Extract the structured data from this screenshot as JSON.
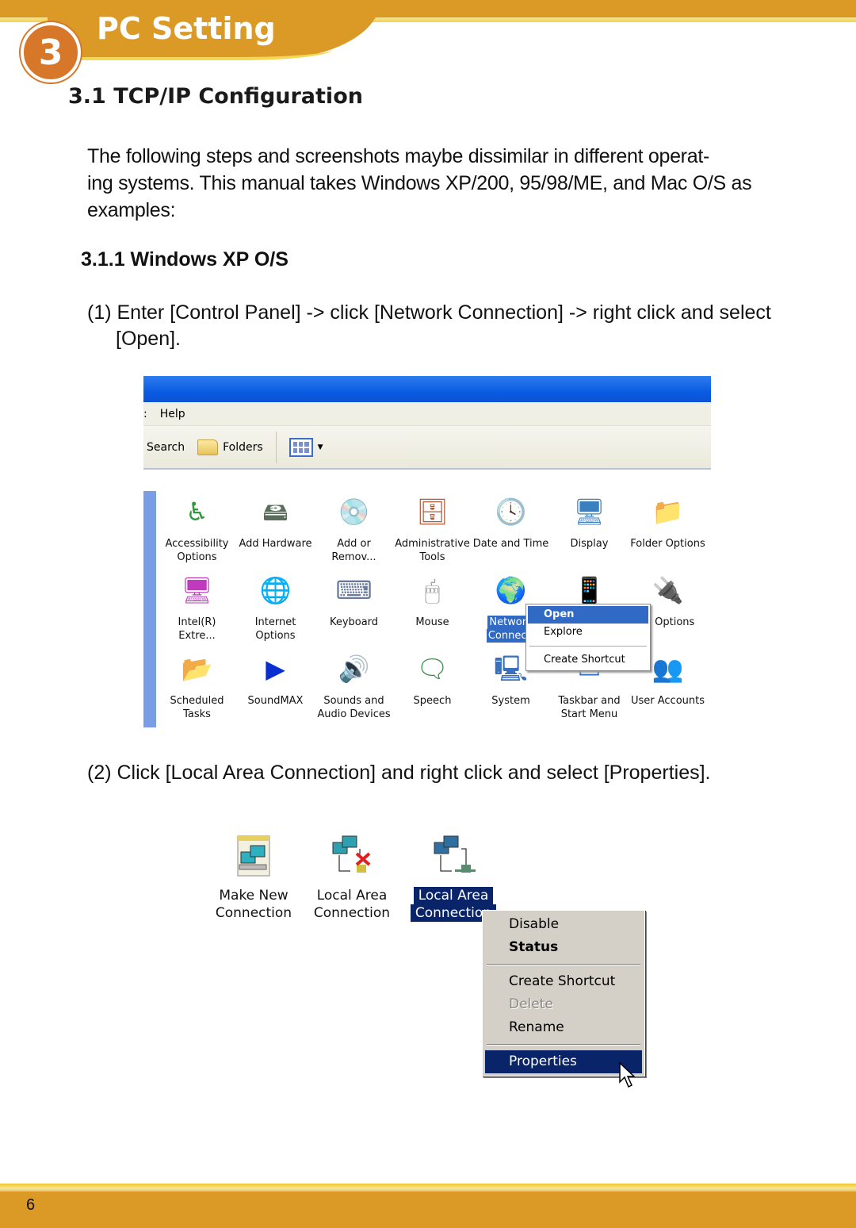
{
  "header": {
    "chapter_number": "3",
    "chapter_title": "PC Setting"
  },
  "section": {
    "title": "3.1 TCP/IP Configuration",
    "intro_line1": "The following steps and screenshots maybe dissimilar in  different operat-",
    "intro_line2": "ing systems. This manual takes Windows XP/200, 95/98/ME, and Mac O/S as",
    "intro_line3": "examples:",
    "subsection_title": "3.1.1 Windows XP O/S"
  },
  "steps": [
    {
      "line1": "(1) Enter [Control Panel] -> click [Network Connection] -> right click and select",
      "line2": "[Open]."
    },
    {
      "line1": "(2) Click [Local Area Connection] and right click and select [Properties]."
    }
  ],
  "screenshot1": {
    "menu": {
      "partial": ":",
      "help": "Help"
    },
    "toolbar": {
      "search": "Search",
      "folders": "Folders"
    },
    "items": [
      {
        "l1": "Accessibility",
        "l2": "Options",
        "icon": "accessibility-icon",
        "glyph": "♿",
        "color": "#2e9a3a"
      },
      {
        "l1": "Add Hardware",
        "l2": "",
        "icon": "add-hardware-icon",
        "glyph": "🖴",
        "color": "#5a6d5a"
      },
      {
        "l1": "Add or",
        "l2": "Remov...",
        "icon": "add-remove-programs-icon",
        "glyph": "💿",
        "color": "#4a7fc0"
      },
      {
        "l1": "Administrative",
        "l2": "Tools",
        "icon": "administrative-tools-icon",
        "glyph": "🗄",
        "color": "#b05a3a"
      },
      {
        "l1": "Date and Time",
        "l2": "",
        "icon": "date-time-icon",
        "glyph": "🕓",
        "color": "#5a7fb0"
      },
      {
        "l1": "Display",
        "l2": "",
        "icon": "display-icon",
        "glyph": "🖥",
        "color": "#3a7fc0"
      },
      {
        "l1": "Folder Options",
        "l2": "",
        "icon": "folder-options-icon",
        "glyph": "📁",
        "color": "#e0b040"
      },
      {
        "l1": "Intel(R)",
        "l2": "Extre...",
        "icon": "intel-graphics-icon",
        "glyph": "🖥",
        "color": "#c03ac0"
      },
      {
        "l1": "Internet",
        "l2": "Options",
        "icon": "internet-options-icon",
        "glyph": "🌐",
        "color": "#2f7fcf"
      },
      {
        "l1": "Keyboard",
        "l2": "",
        "icon": "keyboard-icon",
        "glyph": "⌨",
        "color": "#6a7a9a"
      },
      {
        "l1": "Mouse",
        "l2": "",
        "icon": "mouse-icon",
        "glyph": "🖱",
        "color": "#888888"
      },
      {
        "l1": "Network",
        "l2": "Connecti",
        "icon": "network-connections-icon",
        "glyph": "🌍",
        "color": "#2a6fb0",
        "selected": true
      },
      {
        "l1": "",
        "l2": "",
        "icon": "phone-modem-icon",
        "glyph": "📱",
        "color": "#5a8a5a"
      },
      {
        "l1": "er Options",
        "l2": "",
        "icon": "power-options-icon",
        "glyph": "🔌",
        "color": "#c0a040"
      },
      {
        "l1": "Scheduled",
        "l2": "Tasks",
        "icon": "scheduled-tasks-icon",
        "glyph": "📂",
        "color": "#e0b040"
      },
      {
        "l1": "SoundMAX",
        "l2": "",
        "icon": "soundmax-icon",
        "glyph": "▶",
        "color": "#0a2fd0"
      },
      {
        "l1": "Sounds and",
        "l2": "Audio Devices",
        "icon": "sounds-audio-icon",
        "glyph": "🔊",
        "color": "#707070"
      },
      {
        "l1": "Speech",
        "l2": "",
        "icon": "speech-icon",
        "glyph": "🗨",
        "color": "#3a8a4a"
      },
      {
        "l1": "System",
        "l2": "",
        "icon": "system-icon",
        "glyph": "🖳",
        "color": "#3a6fc0"
      },
      {
        "l1": "Taskbar and",
        "l2": "Start Menu",
        "icon": "taskbar-start-menu-icon",
        "glyph": "▭",
        "color": "#2a70c0"
      },
      {
        "l1": "User Accounts",
        "l2": "",
        "icon": "user-accounts-icon",
        "glyph": "👥",
        "color": "#3a6fa0"
      }
    ],
    "context_menu": {
      "open": "Open",
      "explore": "Explore",
      "create_shortcut": "Create Shortcut"
    }
  },
  "screenshot2": {
    "items": [
      {
        "l1": "Make New",
        "l2": "Connection"
      },
      {
        "l1": "Local Area",
        "l2": "Connection"
      },
      {
        "l1": "Local Area",
        "l2": "Connection"
      }
    ],
    "context_menu": {
      "disable": "Disable",
      "status": "Status",
      "create_shortcut": "Create Shortcut",
      "delete": "Delete",
      "rename": "Rename",
      "properties": "Properties"
    }
  },
  "footer": {
    "page_number": "6"
  },
  "colors": {
    "brand_gold": "#da9a25",
    "chapter_orange": "#d6772a",
    "xp_selection": "#316ac5",
    "classic_selection": "#0a246a"
  }
}
